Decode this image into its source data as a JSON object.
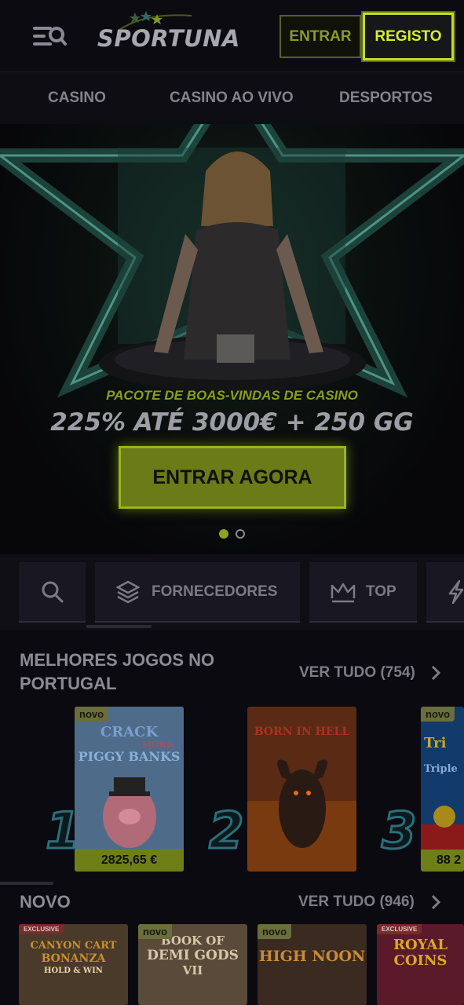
{
  "header": {
    "logo_text": "SPORTUNA",
    "login_label": "ENTRAR",
    "register_label": "REGISTO"
  },
  "topnav": {
    "items": [
      {
        "label": "CASINO"
      },
      {
        "label": "CASINO AO VIVO"
      },
      {
        "label": "DESPORTOS"
      }
    ]
  },
  "hero": {
    "subtitle": "PACOTE DE BOAS-VINDAS DE CASINO",
    "title": "225% ATÉ 3000€ + 250 GG",
    "cta_label": "ENTRAR AGORA",
    "slides_total": 2,
    "active_slide": 1
  },
  "filters": {
    "search_icon": "search-icon",
    "providers_label": "FORNECEDORES",
    "top_label": "TOP",
    "next_icon": "lightning-icon"
  },
  "top_games": {
    "title_line1": "MELHORES JOGOS NO",
    "title_line2": "PORTUGAL",
    "see_all": "VER TUDO (754)",
    "games": [
      {
        "rank": "1",
        "badge": "novo",
        "title_a": "CRACK",
        "title_b": "MORE",
        "title_c": "PIGGY BANKS",
        "price": "2825,65 €"
      },
      {
        "rank": "2",
        "badge": "",
        "title_a": "BORN IN HELL"
      },
      {
        "rank": "3",
        "badge": "novo",
        "title_a": "Tri",
        "title_b": "Triple",
        "price": "88 2"
      }
    ]
  },
  "new_games": {
    "title": "NOVO",
    "see_all": "VER TUDO (946)",
    "games": [
      {
        "badge": "EXCLUSIVE",
        "title_a": "CANYON CART",
        "title_b": "BONANZA",
        "title_c": "HOLD & WIN"
      },
      {
        "badge": "novo",
        "title_a": "BOOK OF",
        "title_b": "DEMI GODS",
        "title_c": "VII"
      },
      {
        "badge": "novo",
        "title_a": "HIGH NOON"
      },
      {
        "badge": "EXCLUSIVE",
        "title_a": "ROYAL",
        "title_b": "COINS"
      }
    ]
  }
}
